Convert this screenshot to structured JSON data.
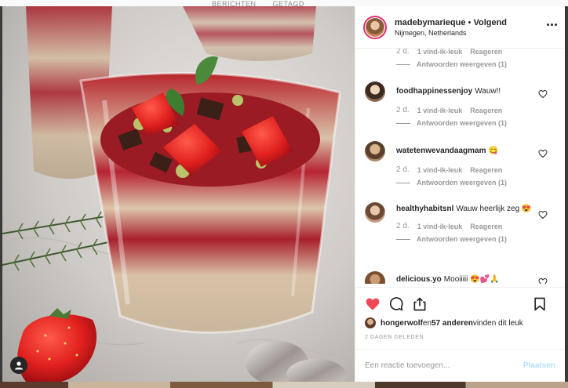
{
  "background": {
    "tabs": [
      "BERICHTEN",
      "GETAGD"
    ]
  },
  "post": {
    "username": "madebymarieque",
    "separator": " • ",
    "follow_label": "Volgend",
    "location": "Nijmegen, Netherlands",
    "more_icon": "more-horizontal-icon"
  },
  "comments": {
    "top_partial": {
      "time": "2 d.",
      "likes": "1 vind-ik-leuk",
      "reply": "Reageren",
      "view_replies": "Antwoorden weergeven (1)"
    },
    "items": [
      {
        "user": "foodhappinessenjoy",
        "text": "Wauw!!",
        "time": "2 d.",
        "likes": "1 vind-ik-leuk",
        "reply": "Reageren",
        "view_replies": "Antwoorden weergeven (1)"
      },
      {
        "user": "watetenwevandaagmam",
        "text": "😋",
        "time": "2 d.",
        "likes": "1 vind-ik-leuk",
        "reply": "Reageren",
        "view_replies": "Antwoorden weergeven (1)"
      },
      {
        "user": "healthyhabitsnl",
        "text": "Wauw heerlijk zeg 😍",
        "time": "2 d.",
        "likes": "1 vind-ik-leuk",
        "reply": "Reageren",
        "view_replies": "Antwoorden weergeven (1)"
      },
      {
        "user": "delicious.yo",
        "text": "Mooiiiii 😍💕🙏"
      }
    ]
  },
  "actions": {
    "like_icon": "heart-filled-icon",
    "comment_icon": "comment-icon",
    "share_icon": "share-icon",
    "save_icon": "bookmark-icon",
    "like_color": "#ed4956"
  },
  "likes": {
    "user": "hongerwolf",
    "middle": " en ",
    "others": "57 anderen",
    "suffix": " vinden dit leuk"
  },
  "date": "2 DAGEN GELEDEN",
  "add_comment": {
    "placeholder": "Een reactie toevoegen...",
    "post_label": "Plaatsen"
  }
}
